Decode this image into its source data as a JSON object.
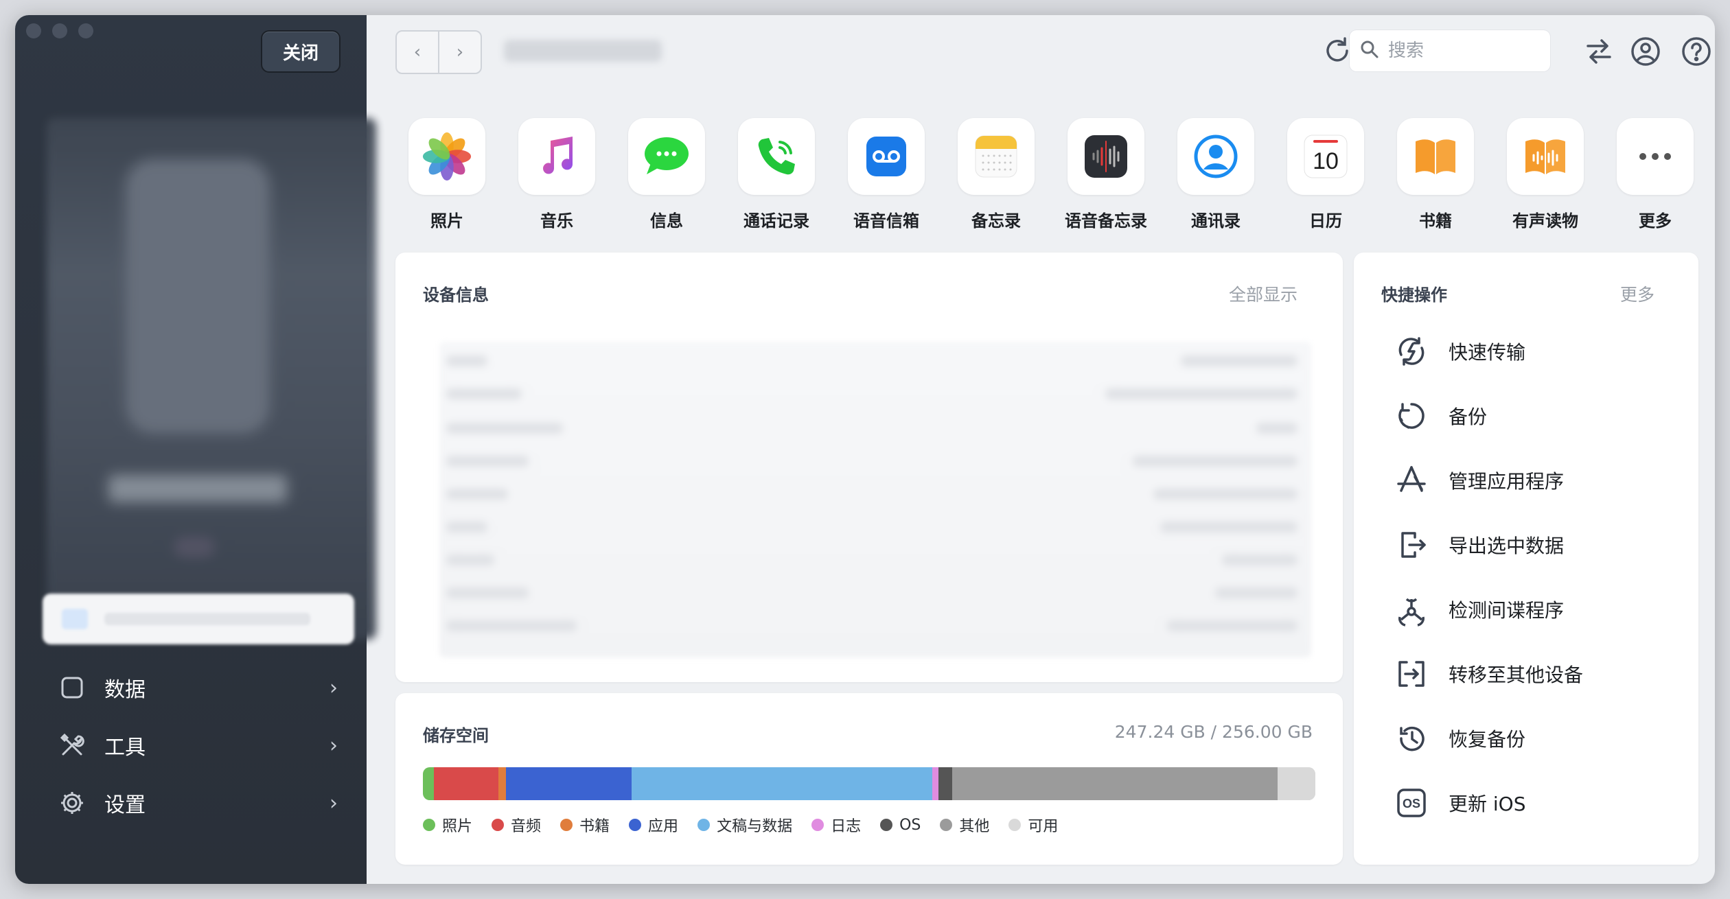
{
  "sidebar": {
    "close_label": "关闭",
    "nav": [
      {
        "label": "数据",
        "icon": "square-icon"
      },
      {
        "label": "工具",
        "icon": "tools-icon"
      },
      {
        "label": "设置",
        "icon": "gear-icon"
      }
    ]
  },
  "toolbar": {
    "back": "‹",
    "forward": "›",
    "search_placeholder": "搜索"
  },
  "apps": [
    {
      "label": "照片",
      "icon": "photos-icon"
    },
    {
      "label": "音乐",
      "icon": "music-icon"
    },
    {
      "label": "信息",
      "icon": "messages-icon"
    },
    {
      "label": "通话记录",
      "icon": "phone-icon"
    },
    {
      "label": "语音信箱",
      "icon": "voicemail-icon"
    },
    {
      "label": "备忘录",
      "icon": "notes-icon"
    },
    {
      "label": "语音备忘录",
      "icon": "voice-memos-icon"
    },
    {
      "label": "通讯录",
      "icon": "contacts-icon"
    },
    {
      "label": "日历",
      "icon": "calendar-icon",
      "day": "10"
    },
    {
      "label": "书籍",
      "icon": "books-icon"
    },
    {
      "label": "有声读物",
      "icon": "audiobooks-icon"
    },
    {
      "label": "更多",
      "icon": "more-icon"
    }
  ],
  "device_info": {
    "title": "设备信息",
    "show_all": "全部显示"
  },
  "storage": {
    "title": "储存空间",
    "usage": "247.24 GB / 256.00 GB",
    "segments": [
      {
        "label": "照片",
        "color": "#6cbf5a",
        "fraction": 0.012
      },
      {
        "label": "音频",
        "color": "#d94a4a",
        "fraction": 0.073
      },
      {
        "label": "书籍",
        "color": "#e07d3c",
        "fraction": 0.008
      },
      {
        "label": "应用",
        "color": "#3b63d1",
        "fraction": 0.141
      },
      {
        "label": "文稿与数据",
        "color": "#6fb4e6",
        "fraction": 0.337
      },
      {
        "label": "日志",
        "color": "#e08ce0",
        "fraction": 0.007
      },
      {
        "label": "OS",
        "color": "#555555",
        "fraction": 0.015
      },
      {
        "label": "其他",
        "color": "#9b9b9b",
        "fraction": 0.365
      },
      {
        "label": "可用",
        "color": "#d9d9d9",
        "fraction": 0.042
      }
    ]
  },
  "quick_actions": {
    "title": "快捷操作",
    "more": "更多",
    "items": [
      {
        "label": "快速传输",
        "icon": "quick-transfer-icon"
      },
      {
        "label": "备份",
        "icon": "backup-icon"
      },
      {
        "label": "管理应用程序",
        "icon": "app-store-icon"
      },
      {
        "label": "导出选中数据",
        "icon": "export-icon"
      },
      {
        "label": "检测间谍程序",
        "icon": "biohazard-icon"
      },
      {
        "label": "转移至其他设备",
        "icon": "transfer-device-icon"
      },
      {
        "label": "恢复备份",
        "icon": "restore-icon"
      },
      {
        "label": "更新 iOS",
        "icon": "ios-icon"
      }
    ]
  }
}
